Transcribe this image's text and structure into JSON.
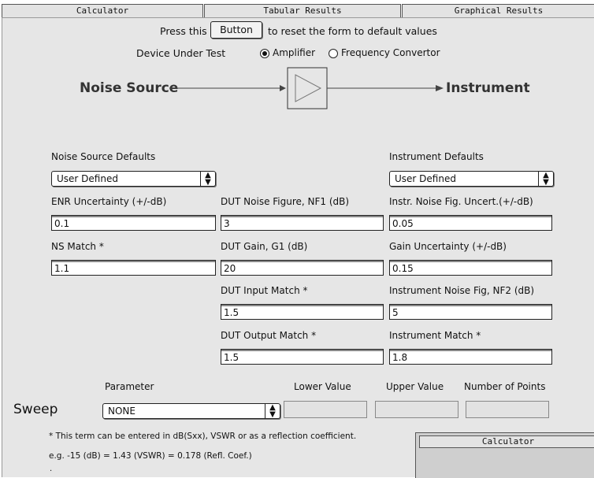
{
  "tabs": [
    "Calculator",
    "Tabular Results",
    "Graphical Results"
  ],
  "reset": {
    "prefix": "Press this",
    "button": "Button",
    "suffix": "to reset the form to default values"
  },
  "dut": {
    "label": "Device Under Test",
    "option1": "Amplifier",
    "option2": "Frequency Convertor",
    "selected": "Amplifier"
  },
  "diagram": {
    "source": "Noise Source",
    "instrument": "Instrument"
  },
  "noise_source": {
    "header": "Noise Source Defaults",
    "select": "User Defined",
    "enr_label": "ENR Uncertainty (+/-dB)",
    "enr_value": "0.1",
    "match_label": "NS Match *",
    "match_value": "1.1"
  },
  "dut_fields": {
    "nf_label": "DUT Noise Figure, NF1 (dB)",
    "nf_value": "3",
    "gain_label": "DUT Gain, G1 (dB)",
    "gain_value": "20",
    "in_label": "DUT Input Match *",
    "in_value": "1.5",
    "out_label": "DUT Output Match *",
    "out_value": "1.5"
  },
  "instrument": {
    "header": "Instrument Defaults",
    "select": "User Defined",
    "nfu_label": "Instr. Noise Fig. Uncert.(+/-dB)",
    "nfu_value": "0.05",
    "gu_label": "Gain Uncertainty (+/-dB)",
    "gu_value": "0.15",
    "nf2_label": "Instrument Noise Fig, NF2 (dB)",
    "nf2_value": "5",
    "match_label": "Instrument Match *",
    "match_value": "1.8"
  },
  "sweep": {
    "parameter_label": "Parameter",
    "lower_label": "Lower Value",
    "upper_label": "Upper Value",
    "points_label": "Number of Points",
    "sweep_label": "Sweep",
    "select": "NONE"
  },
  "notes": {
    "note1": "* This term can be entered in dB(Sxx), VSWR or as a reflection coefficient.",
    "note2": "e.g. -15 (dB) = 1.43 (VSWR) = 0.178 (Refl. Coef.)"
  },
  "calc_window": {
    "title": "Calculator"
  }
}
